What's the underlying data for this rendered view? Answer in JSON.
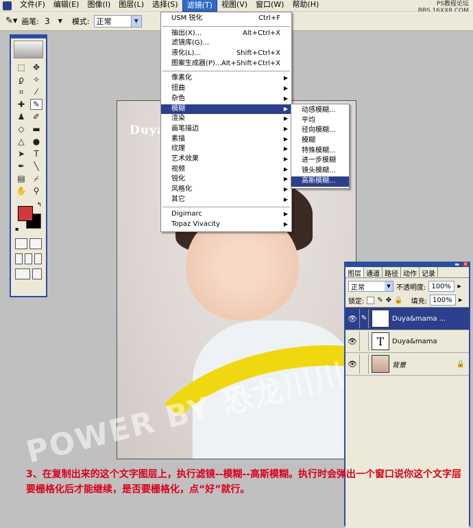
{
  "menubar": {
    "items": [
      "文件(F)",
      "编辑(E)",
      "图像(I)",
      "图层(L)",
      "选择(S)",
      "滤镜(T)",
      "视图(V)",
      "窗口(W)",
      "帮助(H)"
    ],
    "active_index": 5
  },
  "watermark": {
    "line1": "PS教程论坛",
    "line2": "BBS.16XX8.COM"
  },
  "options": {
    "brush_label": "画笔:",
    "brush_size": "3",
    "mode_label": "模式:",
    "mode_value": "正常"
  },
  "canvas": {
    "title_text": "Duya"
  },
  "filter_menu": {
    "items": [
      {
        "label": "USM 锐化",
        "shortcut": "Ctrl+F"
      },
      {
        "sep": true
      },
      {
        "label": "抽出(X)...",
        "shortcut": "Alt+Ctrl+X"
      },
      {
        "label": "滤镜库(G)..."
      },
      {
        "label": "液化(L)...",
        "shortcut": "Shift+Ctrl+X"
      },
      {
        "label": "图案生成器(P)...",
        "shortcut": "Alt+Shift+Ctrl+X"
      },
      {
        "sep": true
      },
      {
        "label": "像素化",
        "submenu": true
      },
      {
        "label": "扭曲",
        "submenu": true
      },
      {
        "label": "杂色",
        "submenu": true
      },
      {
        "label": "模糊",
        "submenu": true,
        "highlighted": true
      },
      {
        "label": "渲染",
        "submenu": true
      },
      {
        "label": "画笔描边",
        "submenu": true
      },
      {
        "label": "素描",
        "submenu": true
      },
      {
        "label": "纹理",
        "submenu": true
      },
      {
        "label": "艺术效果",
        "submenu": true
      },
      {
        "label": "视频",
        "submenu": true
      },
      {
        "label": "锐化",
        "submenu": true
      },
      {
        "label": "风格化",
        "submenu": true
      },
      {
        "label": "其它",
        "submenu": true
      },
      {
        "sep": true
      },
      {
        "label": "Digimarc",
        "submenu": true
      },
      {
        "label": "Topaz Vivacity",
        "submenu": true
      }
    ]
  },
  "blur_submenu": {
    "items": [
      {
        "label": "动感模糊..."
      },
      {
        "label": "平均"
      },
      {
        "label": "径向模糊..."
      },
      {
        "label": "模糊"
      },
      {
        "label": "特殊模糊..."
      },
      {
        "label": "进一步模糊"
      },
      {
        "label": "镜头模糊..."
      },
      {
        "label": "高斯模糊...",
        "highlighted": true
      }
    ]
  },
  "layers_panel": {
    "tabs": [
      "图层",
      "通道",
      "路径",
      "动作",
      "记录"
    ],
    "blend_mode": "正常",
    "opacity_label": "不透明度:",
    "opacity_value": "100%",
    "lock_label": "锁定:",
    "fill_label": "填充:",
    "fill_value": "100%",
    "layers": [
      {
        "name": "Duya&mama ...",
        "thumb": "T",
        "selected": true
      },
      {
        "name": "Duya&mama",
        "thumb": "T",
        "selected": false
      },
      {
        "name": "背景",
        "thumb": "image",
        "selected": false,
        "locked": true
      }
    ]
  },
  "overlay": {
    "power_text": "POWER BY 恐龙川川",
    "caption": "3、在复制出来的这个文字图层上，执行滤镜--模糊--高斯模糊。执行时会弹出一个窗口说你这个文字层要栅格化后才能继续，是否要栅格化，点“好”就行。"
  },
  "colors": {
    "foreground": "#d2383b",
    "background": "#000000",
    "menu_highlight": "#2c3f8c",
    "caption": "#d8001a"
  }
}
